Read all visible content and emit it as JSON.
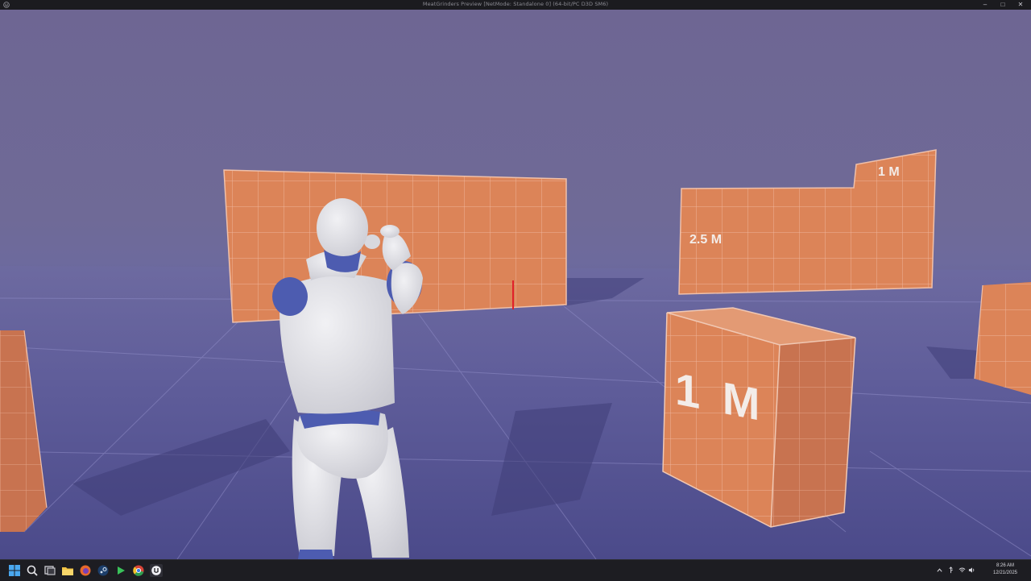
{
  "window": {
    "title": "MeatGrinders Preview [NetMode: Standalone 0] (64-bit/PC D3D SM6)",
    "controls": [
      "–",
      "□",
      "✕"
    ]
  },
  "scene": {
    "size_labels": {
      "back_right_top": "1 M",
      "back_right_left": "2.5 M",
      "front_right": "1 M"
    }
  },
  "colors": {
    "sky": "#6e6693",
    "floor": "#5a5896",
    "wall": "#d9835a",
    "mannequin": "#e2e2e6",
    "mannequin_joint": "#5b6cc0"
  },
  "taskbar": {
    "icons": [
      "windows-start-icon",
      "search-icon",
      "task-view-icon",
      "file-explorer-icon",
      "firefox-icon",
      "steam-icon",
      "play-icon",
      "chrome-icon",
      "unreal-engine-icon"
    ]
  },
  "tray": {
    "icons": [
      "chevron-up-icon",
      "usb-icon",
      "wifi-icon",
      "speaker-icon"
    ],
    "time": "8:26 AM",
    "date": "12/21/2025"
  }
}
